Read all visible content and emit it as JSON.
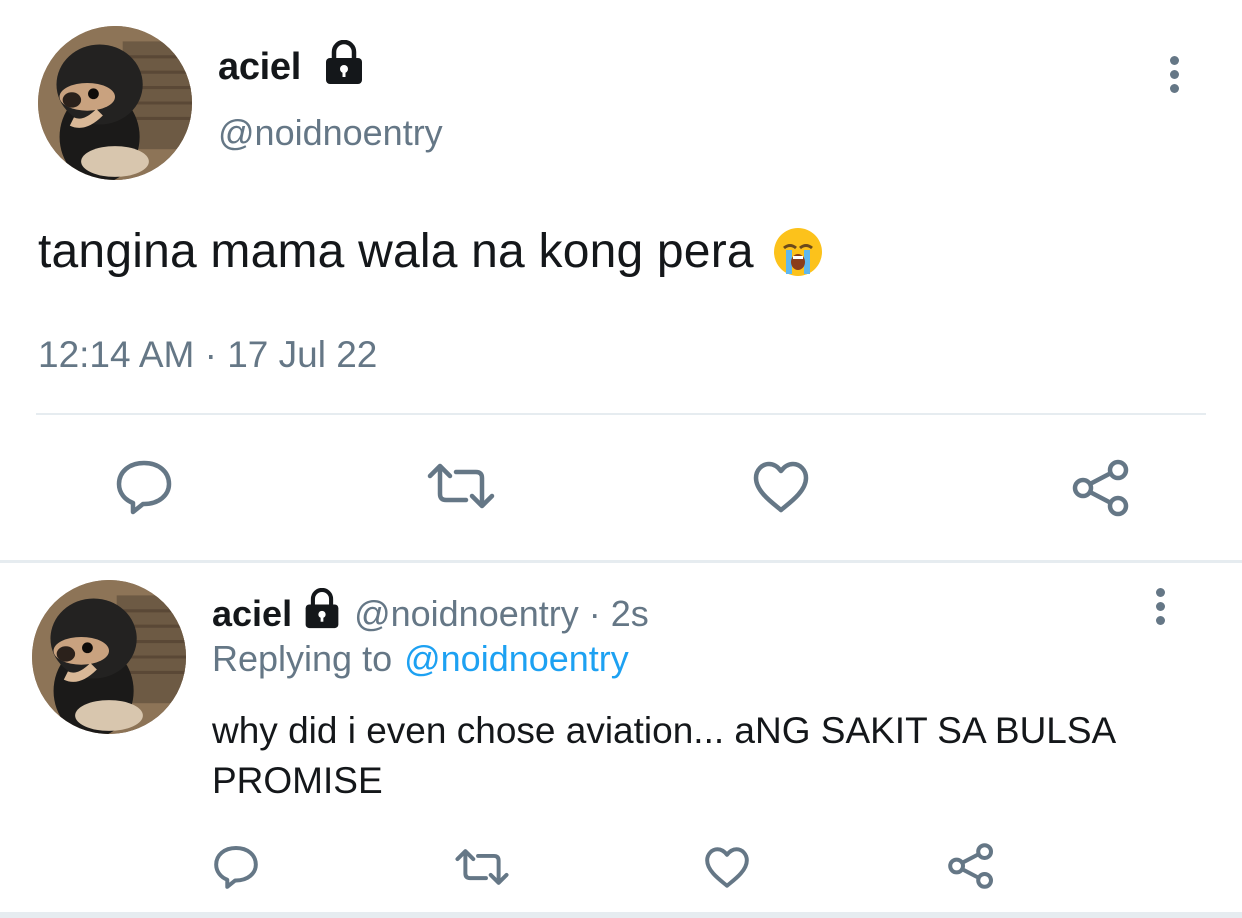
{
  "main_tweet": {
    "author_name": "aciel",
    "handle": "@noidnoentry",
    "text": "tangina mama wala na kong pera",
    "emoji": "crying-face-emoji",
    "timestamp": "12:14 AM · 17 Jul 22",
    "actions": [
      "reply-icon",
      "retweet-icon",
      "like-icon",
      "share-icon"
    ]
  },
  "reply_tweet": {
    "author_name": "aciel",
    "handle": "@noidnoentry",
    "separator": "·",
    "time_ago": "2s",
    "replying_label": "Replying to",
    "replying_to": "@noidnoentry",
    "text": "why did i even chose aviation... aNG SAKIT SA BULSA PROMISE",
    "actions": [
      "reply-icon",
      "retweet-icon",
      "like-icon",
      "share-icon"
    ]
  },
  "colors": {
    "text": "#14171a",
    "secondary": "#657786",
    "link": "#1da1f2",
    "divider": "#e6ecf0"
  }
}
